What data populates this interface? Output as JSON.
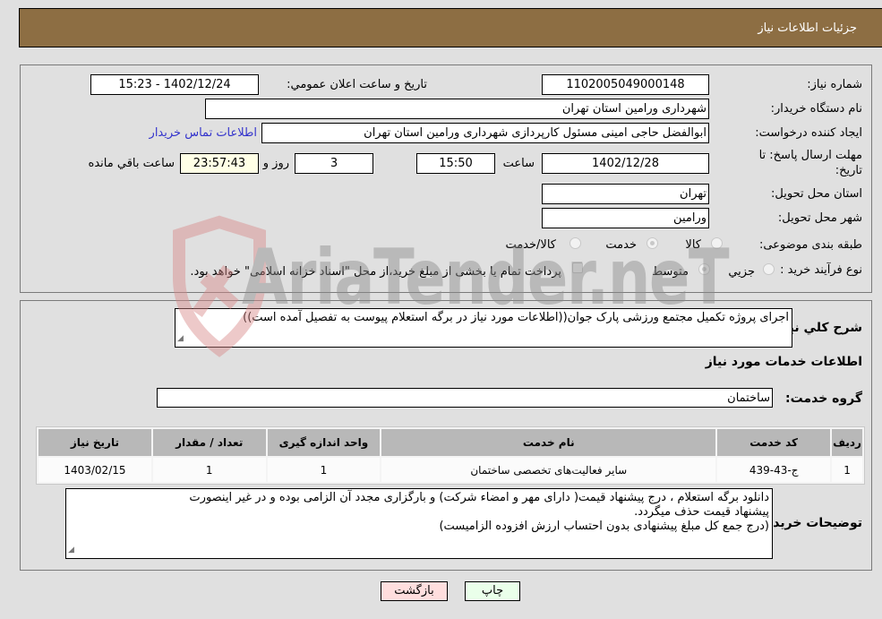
{
  "header": {
    "title": "جزئیات اطلاعات نیاز"
  },
  "details": {
    "need_number_label": "شماره نیاز:",
    "need_number": "1102005049000148",
    "announce_label": "تاريخ و ساعت اعلان عمومي:",
    "announce_value": "1402/12/24 - 15:23",
    "buyer_org_label": "نام دستگاه خريدار:",
    "buyer_org": "شهرداری ورامین استان تهران",
    "creator_label": "ايجاد کننده درخواست:",
    "creator": "ابوالفضل حاجی امینی مسئول کارپردازی شهرداری ورامین استان تهران",
    "contact_link": "اطلاعات تماس خريدار",
    "deadline_label": "مهلت ارسال پاسخ: تا تاریخ:",
    "deadline_date": "1402/12/28",
    "time_label": "ساعت",
    "deadline_time": "15:50",
    "days": "3",
    "days_label": "روز و",
    "remaining": "23:57:43",
    "remaining_label": "ساعت باقي مانده",
    "province_label": "استان محل تحويل:",
    "province": "تهران",
    "city_label": "شهر محل تحويل:",
    "city": "ورامین",
    "category_label": "طبقه بندی موضوعی:",
    "category_options": [
      "کالا",
      "خدمت",
      "کالا/خدمت"
    ],
    "category_selected": "خدمت",
    "process_label": "نوع فرآيند خريد :",
    "process_options": [
      "جزيي",
      "متوسط"
    ],
    "process_selected": "متوسط",
    "treasury_note": "پرداخت تمام يا بخشی از مبلغ خريد،از محل \"اسناد خزانه اسلامی\" خواهد بود."
  },
  "summary": {
    "label": "شرح کلي نياز:",
    "text": "اجرای پروژه تکمیل مجتمع ورزشی پارک جوان((اطلاعات مورد نیاز در برگه استعلام پیوست به تفصیل آمده است))",
    "services_heading": "اطلاعات خدمات مورد نياز",
    "group_label": "گروه خدمت:",
    "group_value": "ساختمان"
  },
  "table": {
    "headers": [
      "رديف",
      "کد خدمت",
      "نام خدمت",
      "واحد اندازه گيری",
      "تعداد / مقدار",
      "تاريخ نياز"
    ],
    "rows": [
      [
        "1",
        "ج-43-439",
        "سایر فعالیت‌های تخصصی ساختمان",
        "1",
        "1",
        "1403/02/15"
      ]
    ]
  },
  "buyer_notes": {
    "label": "توضيحات خريدار:",
    "line1": "دانلود برگه استعلام ، درج پیشنهاد قیمت( دارای مهر و امضاء شرکت) و بارگزاری مجدد آن الزامی بوده و در غیر اینصورت",
    "line2": "پیشنهاد قیمت حذف میگردد.",
    "line3": "(درج  جمع کل مبلغ پیشنهادی بدون احتساب ارزش افزوده الزامیست)"
  },
  "buttons": {
    "print": "چاپ",
    "back": "بازگشت"
  },
  "watermark": "AriaTender.neT",
  "colors": {
    "header_bg": "#8d6e43",
    "link": "#3333cc",
    "print_bg": "#eaffea",
    "back_bg": "#ffdede"
  }
}
